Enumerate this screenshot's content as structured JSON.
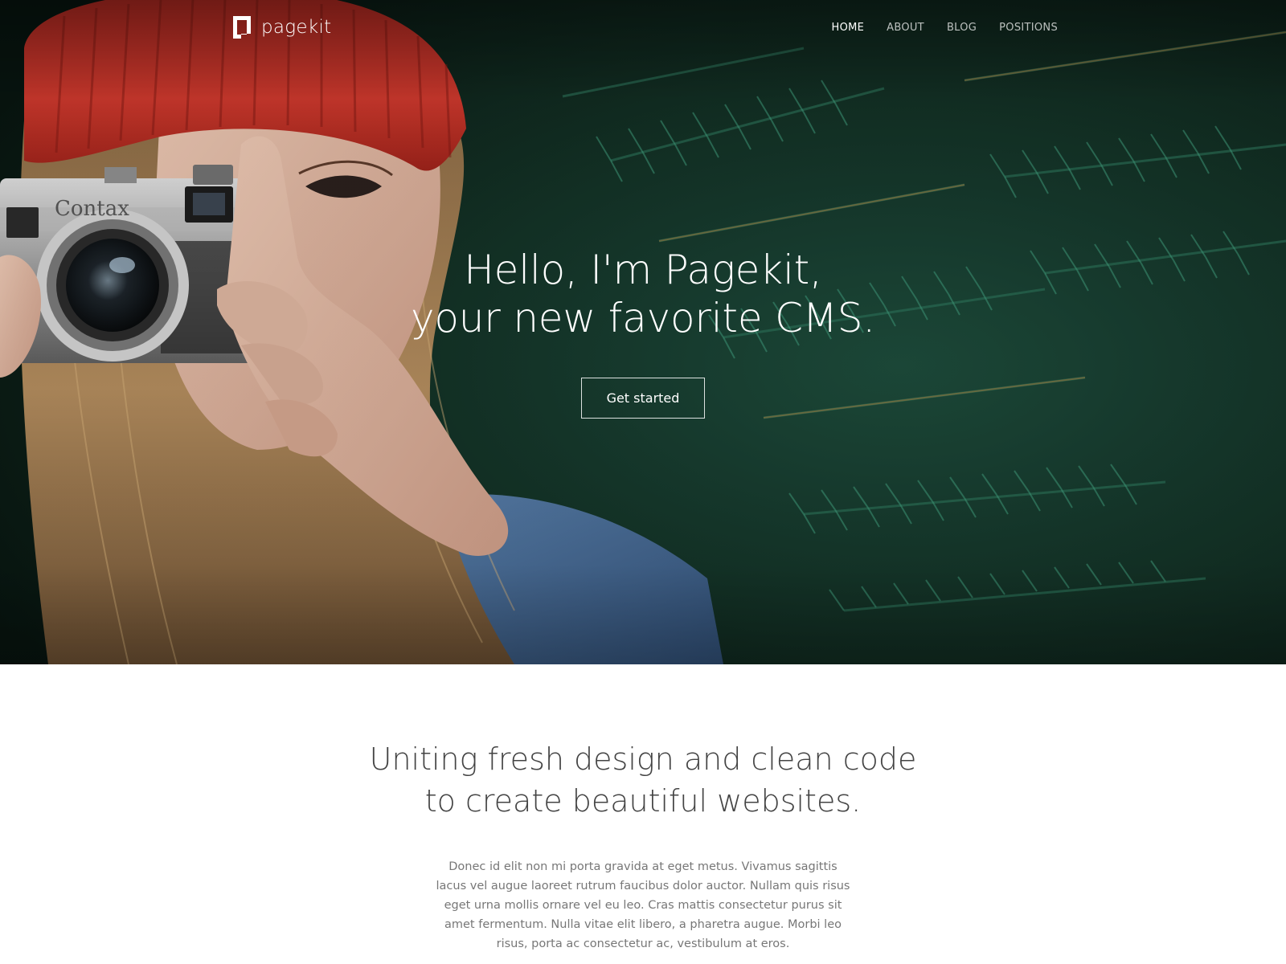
{
  "brand": {
    "name": "pagekit",
    "logo_icon": "pagekit-logo-icon"
  },
  "nav": {
    "items": [
      {
        "label": "HOME",
        "active": true
      },
      {
        "label": "ABOUT",
        "active": false
      },
      {
        "label": "BLOG",
        "active": false
      },
      {
        "label": "POSITIONS",
        "active": false
      }
    ]
  },
  "hero": {
    "title_line1": "Hello, I'm Pagekit,",
    "title_line2": "your new favorite CMS.",
    "cta_label": "Get started",
    "image": "photographer-with-vintage-camera-red-beanie-evergreen-branches"
  },
  "intro": {
    "title_line1": "Uniting fresh design and clean code",
    "title_line2": "to create beautiful websites.",
    "body": "Donec id elit non mi porta gravida at eget metus. Vivamus sagittis lacus vel augue laoreet rutrum faucibus dolor auctor. Nullam quis risus eget urna mollis ornare vel eu leo. Cras mattis consectetur purus sit amet fermentum. Nulla vitae elit libero, a pharetra augue. Morbi leo risus, porta ac consectetur ac, vestibulum at eros."
  },
  "colors": {
    "hero_dark_green": "#0f2a20",
    "beanie_red": "#c0392f",
    "denim_blue": "#4a6f9a",
    "heading_gray": "#444444",
    "body_gray": "#777777"
  }
}
